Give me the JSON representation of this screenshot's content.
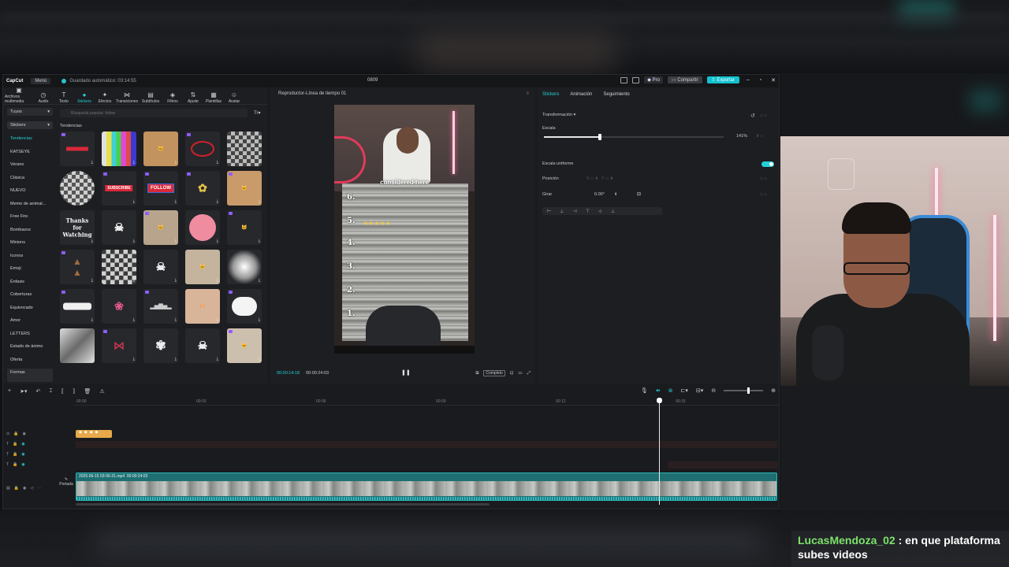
{
  "window": {
    "app_name": "CapCut",
    "menu_label": "Menú",
    "autosave_text": "Guardado automático: 03:14:55",
    "project_name": "0809",
    "pro_label": "Pro",
    "share_label": "Compartir",
    "export_label": "Exportar"
  },
  "toolbar": {
    "items": [
      {
        "label": "Archivos multimedia",
        "icon": "media-icon"
      },
      {
        "label": "Audio",
        "icon": "audio-icon"
      },
      {
        "label": "Texto",
        "icon": "text-icon"
      },
      {
        "label": "Stickers",
        "icon": "sticker-icon"
      },
      {
        "label": "Efectos",
        "icon": "effects-icon"
      },
      {
        "label": "Transiciones",
        "icon": "transitions-icon"
      },
      {
        "label": "Subtítulos",
        "icon": "subtitles-icon"
      },
      {
        "label": "Filtros",
        "icon": "filters-icon"
      },
      {
        "label": "Ajuste",
        "icon": "adjust-icon"
      },
      {
        "label": "Plantillas",
        "icon": "templates-icon"
      },
      {
        "label": "Avatar",
        "icon": "avatar-icon"
      }
    ]
  },
  "sidebar": {
    "group_yours": "Tuyos",
    "group_stickers": "Stickers",
    "categories": [
      "Tendencias",
      "KATSEYE",
      "Verano",
      "Clásica",
      "NUEVO",
      "Meme de animal...",
      "Free Fire",
      "Bombazos",
      "Minions",
      "Iconos",
      "Emoji",
      "Énfasis",
      "Coberturas",
      "Equivocado",
      "Amor",
      "LETTERS",
      "Estado de ánimo",
      "Oferta",
      "Formas"
    ]
  },
  "stickers": {
    "search_placeholder": "Búsqueda popular: follow",
    "section_title": "Tendencias",
    "grid_texts": [
      "SUBSCRIBE",
      "FOLLOW",
      "Thanks for Watching"
    ]
  },
  "player": {
    "title": "Reproductor-Línea de tiempo 01",
    "caption": "considered here",
    "numbers": [
      "6.",
      "5.",
      "4.",
      "3.",
      "2.",
      "1."
    ],
    "current_time": "00:00:14:18",
    "total_time": "00:00:24:03",
    "full_label": "Completo"
  },
  "inspector": {
    "tabs": [
      "Stickers",
      "Animación",
      "Seguimiento"
    ],
    "section": "Transformación",
    "scale_label": "Escala",
    "scale_value": "141%",
    "scale_level": 0.141,
    "uniform_label": "Escala uniforme",
    "position_label": "Posición",
    "rotate_label": "Girar",
    "rotate_value": "0.00°"
  },
  "timeline": {
    "ticks": [
      "00:00",
      "00:03",
      "00:06",
      "00:09",
      "00:12",
      "00:15"
    ],
    "clip_label": "2025-06-15 03-56-31.mp4",
    "clip_duration": "00:00:24:03",
    "cover_label": "Portada"
  },
  "chat": {
    "username": "LucasMendoza_02",
    "separator": " : ",
    "message": "en que plataforma subes videos"
  },
  "colors": {
    "accent": "#23d0d8",
    "export": "#12c2cf",
    "sticker_clip": "#e7a94a",
    "main_clip": "#1f6f72",
    "chat_user": "#7ee26b"
  }
}
